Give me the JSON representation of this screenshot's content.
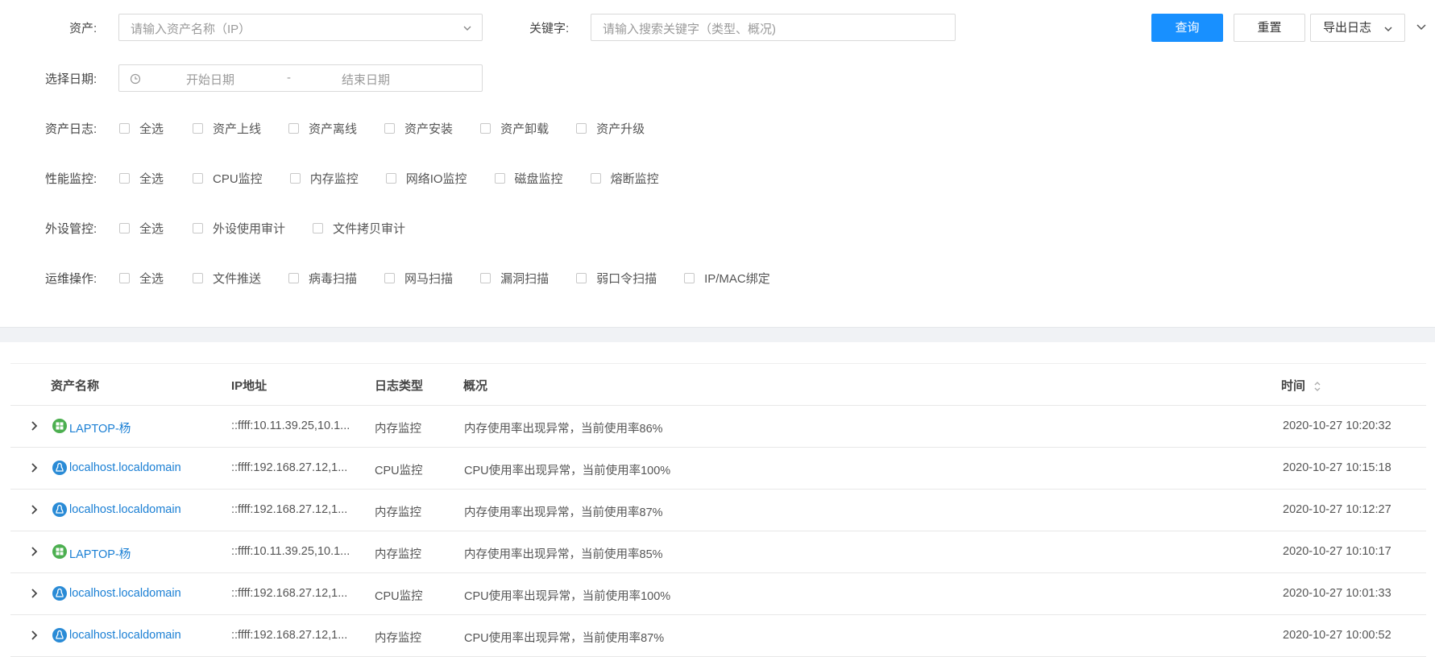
{
  "filters": {
    "asset_label": "资产:",
    "asset_placeholder": "请输入资产名称（IP）",
    "keyword_label": "关键字:",
    "keyword_placeholder": "请输入搜索关键字（类型、概况)",
    "date_label": "选择日期:",
    "date_start_placeholder": "开始日期",
    "date_separator": "-",
    "date_end_placeholder": "结束日期"
  },
  "buttons": {
    "query": "查询",
    "reset": "重置",
    "export": "导出日志"
  },
  "checkbox_groups": [
    {
      "label": "资产日志:",
      "items": [
        "全选",
        "资产上线",
        "资产离线",
        "资产安装",
        "资产卸载",
        "资产升级"
      ]
    },
    {
      "label": "性能监控:",
      "items": [
        "全选",
        "CPU监控",
        "内存监控",
        "网络IO监控",
        "磁盘监控",
        "熔断监控"
      ]
    },
    {
      "label": "外设管控:",
      "items": [
        "全选",
        "外设使用审计",
        "文件拷贝审计"
      ]
    },
    {
      "label": "运维操作:",
      "items": [
        "全选",
        "文件推送",
        "病毒扫描",
        "网马扫描",
        "漏洞扫描",
        "弱口令扫描",
        "IP/MAC绑定"
      ]
    }
  ],
  "table": {
    "headers": {
      "name": "资产名称",
      "ip": "IP地址",
      "type": "日志类型",
      "summary": "概况",
      "time": "时间"
    },
    "rows": [
      {
        "os": "windows",
        "name": "LAPTOP-杨",
        "ip": "::ffff:10.11.39.25,10.1...",
        "type": "内存监控",
        "summary": "内存使用率出现异常，当前使用率86%",
        "time": "2020-10-27 10:20:32"
      },
      {
        "os": "linux",
        "name": "localhost.localdomain",
        "ip": "::ffff:192.168.27.12,1...",
        "type": "CPU监控",
        "summary": "CPU使用率出现异常，当前使用率100%",
        "time": "2020-10-27 10:15:18"
      },
      {
        "os": "linux",
        "name": "localhost.localdomain",
        "ip": "::ffff:192.168.27.12,1...",
        "type": "内存监控",
        "summary": "内存使用率出现异常，当前使用率87%",
        "time": "2020-10-27 10:12:27"
      },
      {
        "os": "windows",
        "name": "LAPTOP-杨",
        "ip": "::ffff:10.11.39.25,10.1...",
        "type": "内存监控",
        "summary": "内存使用率出现异常，当前使用率85%",
        "time": "2020-10-27 10:10:17"
      },
      {
        "os": "linux",
        "name": "localhost.localdomain",
        "ip": "::ffff:192.168.27.12,1...",
        "type": "CPU监控",
        "summary": "CPU使用率出现异常，当前使用率100%",
        "time": "2020-10-27 10:01:33"
      },
      {
        "os": "linux",
        "name": "localhost.localdomain",
        "ip": "::ffff:192.168.27.12,1...",
        "type": "内存监控",
        "summary": "CPU使用率出现异常，当前使用率87%",
        "time": "2020-10-27 10:00:52"
      }
    ]
  },
  "colors": {
    "primary": "#1890ff",
    "link": "#1a7fd4",
    "windows_icon": "#4caf50",
    "linux_icon": "#2a8bd6"
  },
  "icons": {
    "clock": "clock-icon",
    "dropdown": "chevron-down-icon",
    "expand": "chevron-right-icon",
    "sort": "sort-icon",
    "windows": "windows-icon",
    "linux": "linux-icon"
  }
}
